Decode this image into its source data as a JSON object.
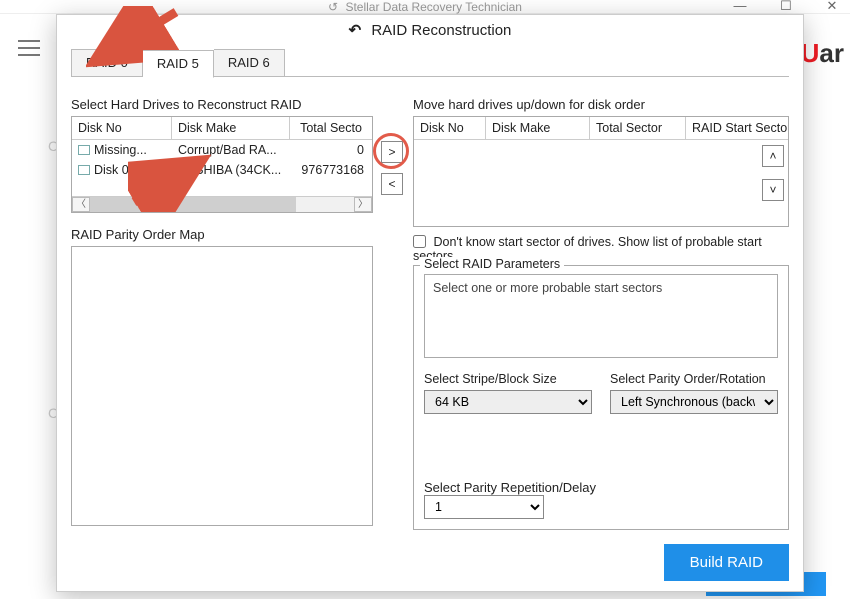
{
  "app": {
    "title": "Stellar Data Recovery Technician",
    "brand_pre": "U",
    "brand_post": "ar"
  },
  "dialog": {
    "title": "RAID Reconstruction",
    "tabs": [
      "RAID 0",
      "RAID 5",
      "RAID 6"
    ],
    "active_tab": 1
  },
  "left": {
    "label": "Select Hard Drives to Reconstruct RAID",
    "headers": [
      "Disk No",
      "Disk Make",
      "Total Secto"
    ],
    "rows": [
      {
        "no": "Missing...",
        "make": "Corrupt/Bad RA...",
        "sectors": "0"
      },
      {
        "no": "Disk 0",
        "make": "TOSHIBA (34CK...",
        "sectors": "976773168"
      }
    ],
    "parity_map_label": "RAID Parity Order Map"
  },
  "move": {
    "right": ">",
    "left": "<"
  },
  "right": {
    "label": "Move hard drives up/down for disk order",
    "headers": [
      "Disk No",
      "Disk Make",
      "Total Sector",
      "RAID Start Sector"
    ],
    "up": "˄",
    "down": "˅",
    "checkbox": "Don't know start sector of drives. Show list of probable start sectors",
    "params_legend": "Select RAID Parameters",
    "probable_label": "Select one or more probable start sectors",
    "stripe_label": "Select Stripe/Block Size",
    "stripe_value": "64 KB",
    "parity_label": "Select Parity Order/Rotation",
    "parity_value": "Left Synchronous (backward",
    "delay_label": "Select Parity Repetition/Delay",
    "delay_value": "1"
  },
  "build_label": "Build RAID"
}
